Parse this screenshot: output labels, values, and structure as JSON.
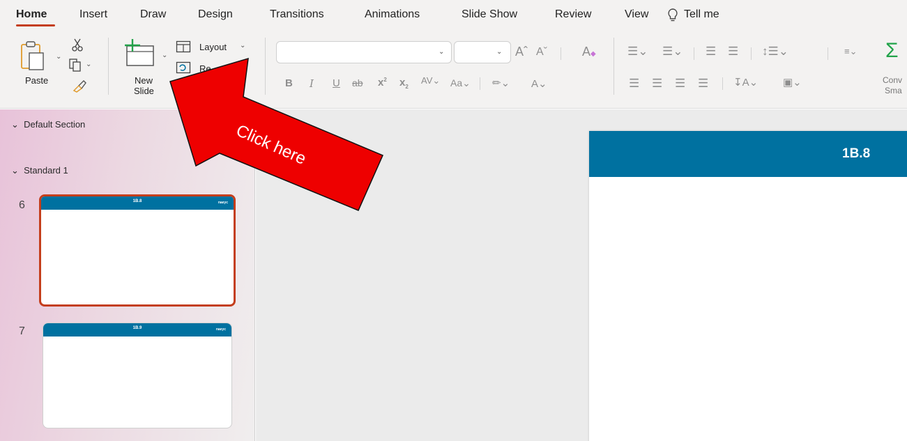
{
  "tabs": [
    {
      "label": "Home",
      "active": true
    },
    {
      "label": "Insert"
    },
    {
      "label": "Draw"
    },
    {
      "label": "Design"
    },
    {
      "label": "Transitions"
    },
    {
      "label": "Animations"
    },
    {
      "label": "Slide Show"
    },
    {
      "label": "Review"
    },
    {
      "label": "View"
    }
  ],
  "tell_me": "Tell me",
  "ribbon": {
    "paste_label": "Paste",
    "new_slide_label_1": "New",
    "new_slide_label_2": "Slide",
    "layout_label": "Layout",
    "reset_label_partial": "Re",
    "font_name_value": "",
    "font_size_value": "",
    "convert_label_1": "Conv",
    "convert_label_2": "Sma"
  },
  "sidebar": {
    "sections": [
      "Default Section",
      "Standard 1"
    ],
    "slides": [
      {
        "number": "6",
        "title": "1B.8",
        "logo": "naeyc",
        "selected": true
      },
      {
        "number": "7",
        "title": "1B.9",
        "logo": "naeyc",
        "selected": false
      }
    ]
  },
  "main": {
    "slide_title": "1B.8"
  },
  "annotation": {
    "text": "Click here",
    "color": "#ee0000"
  },
  "colors": {
    "accent": "#c43e1c",
    "slide_header": "#0071a0"
  }
}
